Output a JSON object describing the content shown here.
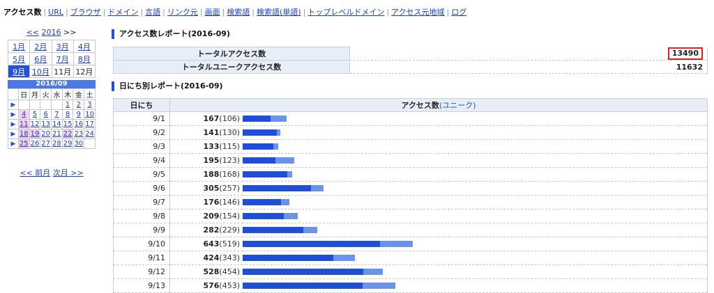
{
  "nav": {
    "items": [
      {
        "label": "アクセス数",
        "active": true
      },
      {
        "label": "URL"
      },
      {
        "label": "ブラウザ"
      },
      {
        "label": "ドメイン"
      },
      {
        "label": "言語"
      },
      {
        "label": "リンク元"
      },
      {
        "label": "画面"
      },
      {
        "label": "検索語"
      },
      {
        "label": "検索語(単語)"
      },
      {
        "label": "トップレベルドメイン"
      },
      {
        "label": "アクセス元地域"
      },
      {
        "label": "ログ"
      }
    ]
  },
  "sidebar": {
    "year_prev": "<<",
    "year": "2016",
    "year_next": ">>",
    "months": [
      "1月",
      "2月",
      "3月",
      "4月",
      "5月",
      "6月",
      "7月",
      "8月",
      "9月",
      "10月",
      "11月",
      "12月"
    ],
    "current_month_index": 8,
    "calendar": {
      "title": "2016/09",
      "weekdays": [
        "日",
        "月",
        "火",
        "水",
        "木",
        "金",
        "土"
      ],
      "weeks": [
        [
          "",
          "",
          "",
          "",
          "1",
          "2",
          "3"
        ],
        [
          "4",
          "5",
          "6",
          "7",
          "8",
          "9",
          "10"
        ],
        [
          "11",
          "12",
          "13",
          "14",
          "15",
          "16",
          "17"
        ],
        [
          "18",
          "19",
          "20",
          "21",
          "22",
          "23",
          "24"
        ],
        [
          "25",
          "26",
          "27",
          "28",
          "29",
          "30",
          ""
        ]
      ],
      "prev_label": "<< 前月",
      "next_label": "次月 >>"
    }
  },
  "summary": {
    "title": "アクセス数レポート(2016-09)",
    "total_label": "トータルアクセス数",
    "total_value": "13490",
    "unique_label": "トータルユニークアクセス数",
    "unique_value": "11632"
  },
  "daily": {
    "title": "日にち別レポート(2016-09)",
    "col_day": "日にち",
    "col_access": "アクセス数",
    "col_access_sub": "(ユニーク)",
    "scale_max": 2000,
    "rows": [
      {
        "day": "9/1",
        "total": 167,
        "unique": 106
      },
      {
        "day": "9/2",
        "total": 141,
        "unique": 130
      },
      {
        "day": "9/3",
        "total": 133,
        "unique": 115
      },
      {
        "day": "9/4",
        "total": 195,
        "unique": 123
      },
      {
        "day": "9/5",
        "total": 188,
        "unique": 168
      },
      {
        "day": "9/6",
        "total": 305,
        "unique": 257
      },
      {
        "day": "9/7",
        "total": 176,
        "unique": 146
      },
      {
        "day": "9/8",
        "total": 209,
        "unique": 154
      },
      {
        "day": "9/9",
        "total": 282,
        "unique": 229
      },
      {
        "day": "9/10",
        "total": 643,
        "unique": 519
      },
      {
        "day": "9/11",
        "total": 424,
        "unique": 343
      },
      {
        "day": "9/12",
        "total": 528,
        "unique": 454
      },
      {
        "day": "9/13",
        "total": 576,
        "unique": 453
      }
    ]
  },
  "colors": {
    "accent": "#2451d8",
    "bar_total": "#6a93ee",
    "bar_unique": "#1f4ed8",
    "highlight": "#e02020"
  }
}
